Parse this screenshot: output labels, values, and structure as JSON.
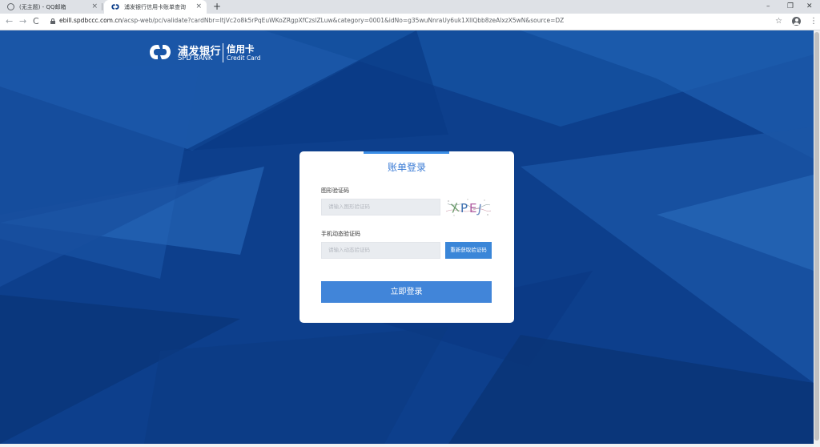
{
  "browser": {
    "tabs": [
      {
        "title": "(无主题) - QQ邮箱",
        "close": "×"
      },
      {
        "title": "浦发银行信用卡账单查询",
        "close": "×"
      }
    ],
    "new_tab": "+",
    "window_controls": {
      "minimize": "–",
      "restore": "❐",
      "close": "✕"
    },
    "nav": {
      "back": "←",
      "forward": "→",
      "reload": "C"
    },
    "url_host": "ebill.spdbccc.com.cn",
    "url_rest": "/acsp-web/pc/validate?cardNbr=ItjVc2o8k5rPqEuWKoZRgpXfCzslZLuw&category=0001&idNo=g35wuNnraUy6uk1XlIQbb8zeAlxzX5wN&source=DZ",
    "star": "☆",
    "menu": "⋮"
  },
  "brand": {
    "name_cn": "浦发银行",
    "name_en": "SPD BANK",
    "product_cn": "信用卡",
    "product_en": "Credit Card",
    "color": "#0c3e8a"
  },
  "login": {
    "title": "账单登录",
    "captcha_label": "图形验证码",
    "captcha_placeholder": "请输入图形验证码",
    "captcha_text": "XPEJ",
    "sms_label": "手机动态验证码",
    "sms_placeholder": "请输入动态验证码",
    "sms_button": "重新获取验证码",
    "submit_button": "立即登录",
    "accent_color": "#3b8ee6"
  }
}
